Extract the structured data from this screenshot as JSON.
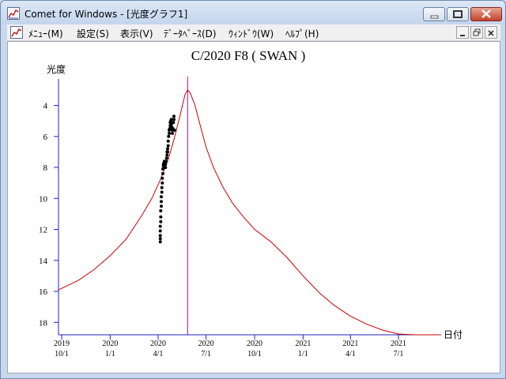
{
  "window": {
    "title": "Comet for Windows - [光度グラフ1]",
    "minimize_icon": "minimize-icon",
    "maximize_icon": "maximize-icon",
    "close_icon": "close-icon"
  },
  "menu": {
    "items": [
      "ﾒﾆｭｰ(M)",
      "設定(S)",
      "表示(V)",
      "ﾃﾞｰﾀﾍﾞｰｽ(D)",
      "ｳｨﾝﾄﾞｳ(W)",
      "ﾍﾙﾌﾟ(H)"
    ],
    "mdi_buttons": [
      "minimize-icon",
      "restore-icon",
      "close-icon"
    ]
  },
  "chart_data": {
    "type": "line",
    "title": "C/2020 F8 ( SWAN )",
    "ylabel": "光度",
    "xlabel": "日付",
    "yticks": [
      4,
      6,
      8,
      10,
      12,
      14,
      16,
      18
    ],
    "ylim": [
      18.8,
      2.8
    ],
    "xlim": [
      "2019-09-25",
      "2021-09-20"
    ],
    "xticks": [
      {
        "date": "2019-10-01",
        "year": "2019",
        "md": "10/1"
      },
      {
        "date": "2020-01-01",
        "year": "2020",
        "md": "1/1"
      },
      {
        "date": "2020-04-01",
        "year": "2020",
        "md": "4/1"
      },
      {
        "date": "2020-07-01",
        "year": "2020",
        "md": "7/1"
      },
      {
        "date": "2020-10-01",
        "year": "2020",
        "md": "10/1"
      },
      {
        "date": "2021-01-01",
        "year": "2021",
        "md": "1/1"
      },
      {
        "date": "2021-04-01",
        "year": "2021",
        "md": "4/1"
      },
      {
        "date": "2021-07-01",
        "year": "2021",
        "md": "7/1"
      }
    ],
    "current_date": "2020-05-27",
    "predicted_curve": {
      "color": "#cc0000",
      "x": [
        "2019-09-25",
        "2019-11-01",
        "2019-12-01",
        "2020-01-01",
        "2020-02-01",
        "2020-03-01",
        "2020-03-20",
        "2020-04-05",
        "2020-04-20",
        "2020-05-01",
        "2020-05-10",
        "2020-05-17",
        "2020-05-22",
        "2020-05-27",
        "2020-06-01",
        "2020-06-10",
        "2020-06-20",
        "2020-07-01",
        "2020-07-15",
        "2020-08-01",
        "2020-08-20",
        "2020-09-10",
        "2020-10-01",
        "2020-11-01",
        "2020-12-01",
        "2021-01-01",
        "2021-02-01",
        "2021-03-01",
        "2021-04-01",
        "2021-05-01",
        "2021-06-01",
        "2021-07-01",
        "2021-08-01",
        "2021-09-01",
        "2021-09-20"
      ],
      "y": [
        15.9,
        15.3,
        14.6,
        13.7,
        12.6,
        11.1,
        10.0,
        8.8,
        7.5,
        6.2,
        5.0,
        4.0,
        3.3,
        3.0,
        3.2,
        4.0,
        5.3,
        6.7,
        8.0,
        9.2,
        10.3,
        11.2,
        12.0,
        12.8,
        13.8,
        15.0,
        16.1,
        16.9,
        17.6,
        18.1,
        18.5,
        18.75,
        18.8,
        18.8,
        18.8
      ]
    },
    "observations": {
      "color": "#000000",
      "x": [
        "2020-04-05",
        "2020-04-05",
        "2020-04-05",
        "2020-04-05",
        "2020-04-05",
        "2020-04-06",
        "2020-04-06",
        "2020-04-06",
        "2020-04-07",
        "2020-04-07",
        "2020-04-07",
        "2020-04-08",
        "2020-04-08",
        "2020-04-09",
        "2020-04-09",
        "2020-04-10",
        "2020-04-10",
        "2020-04-11",
        "2020-04-11",
        "2020-04-12",
        "2020-04-13",
        "2020-04-14",
        "2020-04-15",
        "2020-04-15",
        "2020-04-16",
        "2020-04-17",
        "2020-04-18",
        "2020-04-18",
        "2020-04-19",
        "2020-04-19",
        "2020-04-20",
        "2020-04-20",
        "2020-04-21",
        "2020-04-22",
        "2020-04-22",
        "2020-04-23",
        "2020-04-24",
        "2020-04-24",
        "2020-04-25",
        "2020-04-26",
        "2020-04-26",
        "2020-04-27",
        "2020-04-28",
        "2020-04-28",
        "2020-04-29",
        "2020-04-30",
        "2020-05-01",
        "2020-05-01",
        "2020-05-02"
      ],
      "y": [
        12.8,
        12.6,
        12.4,
        12.1,
        11.8,
        11.5,
        11.2,
        10.8,
        10.5,
        10.2,
        9.9,
        9.6,
        9.3,
        9.0,
        8.7,
        8.4,
        8.1,
        7.9,
        7.8,
        7.7,
        7.6,
        7.8,
        8.0,
        7.8,
        7.6,
        7.4,
        7.2,
        7.0,
        6.8,
        7.0,
        6.6,
        6.3,
        6.0,
        5.8,
        5.6,
        5.5,
        5.3,
        5.1,
        5.0,
        4.9,
        5.2,
        5.4,
        5.6,
        5.8,
        5.5,
        5.1,
        4.9,
        4.7,
        5.6
      ]
    }
  }
}
